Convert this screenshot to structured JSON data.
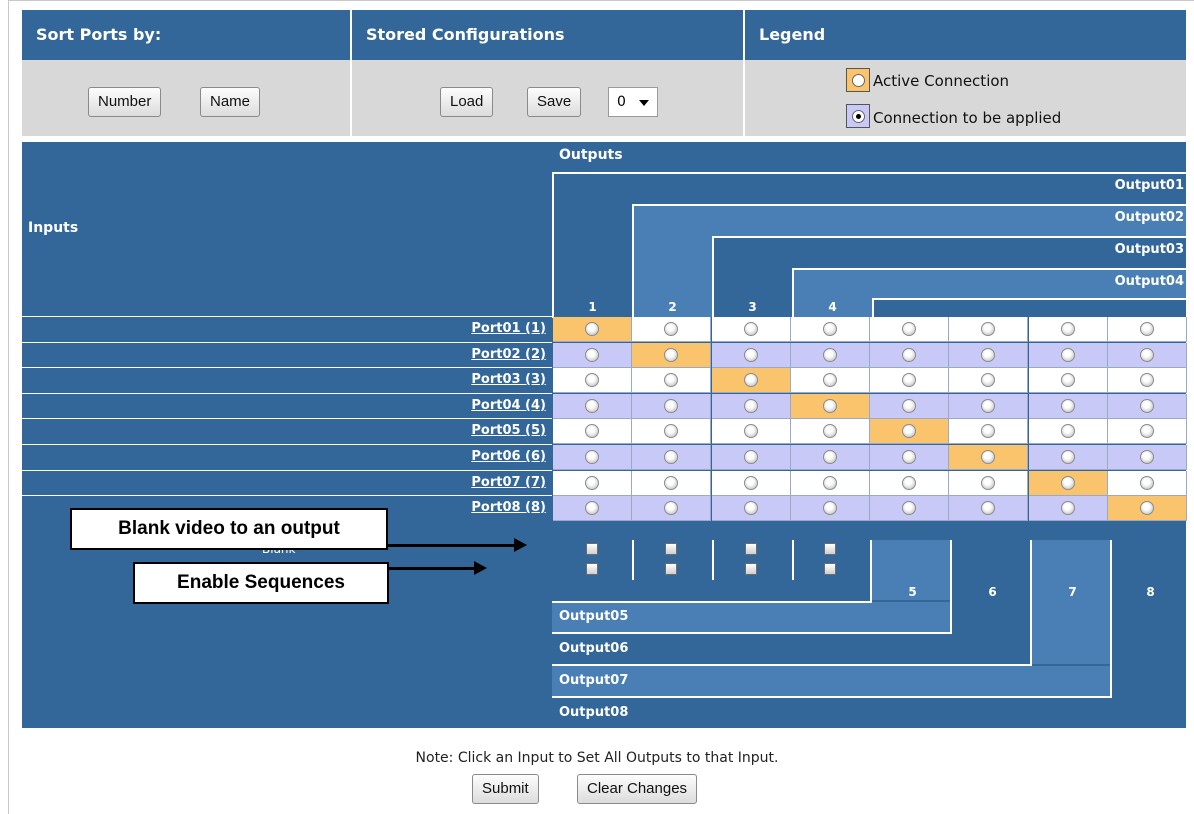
{
  "header": {
    "sort_title": "Sort Ports by:",
    "stored_title": "Stored Configurations",
    "legend_title": "Legend"
  },
  "toolbar": {
    "number_label": "Number",
    "name_label": "Name",
    "load_label": "Load",
    "save_label": "Save",
    "config_select_value": "0"
  },
  "legend": {
    "active_label": "Active Connection",
    "applied_label": "Connection to be applied"
  },
  "matrix": {
    "outputs_title": "Outputs",
    "inputs_title": "Inputs",
    "blank_label": "Blank",
    "output_names": [
      "Output01",
      "Output02",
      "Output03",
      "Output04",
      "Output05",
      "Output06",
      "Output07",
      "Output08"
    ],
    "column_numbers": [
      "1",
      "2",
      "3",
      "4",
      "5",
      "6",
      "7",
      "8"
    ],
    "inputs": [
      "Port01 (1)",
      "Port02 (2)",
      "Port03 (3)",
      "Port04 (4)",
      "Port05 (5)",
      "Port06 (6)",
      "Port07 (7)",
      "Port08 (8)"
    ],
    "active_connections": [
      1,
      2,
      3,
      4,
      5,
      6,
      7,
      8
    ]
  },
  "callouts": {
    "blank_video": "Blank video to an output",
    "enable_sequences": "Enable Sequences"
  },
  "footer": {
    "note": "Note: Click an Input to Set All Outputs to that Input.",
    "submit_label": "Submit",
    "clear_label": "Clear Changes"
  },
  "colors": {
    "header_blue": "#336699",
    "light_blue": "#4a7fb5",
    "active_orange": "#f9c46b",
    "pending_lavender": "#c9c9f7",
    "toolbar_gray": "#d8d8d8"
  }
}
